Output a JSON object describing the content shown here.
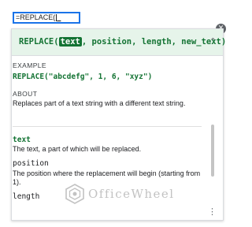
{
  "cell_input": {
    "prefix": "=REPLACE(",
    "suffix": "_"
  },
  "header": {
    "function_name": "REPLACE(",
    "highlighted_arg": "text",
    "rest_signature": ", position, length, new_text)"
  },
  "example": {
    "label": "EXAMPLE",
    "code": "REPLACE(\"abcdefg\", 1, 6, \"xyz\")"
  },
  "about": {
    "label": "ABOUT",
    "text": "Replaces part of a text string with a different text string."
  },
  "arguments": [
    {
      "name": "text",
      "description": "The text, a part of which will be replaced."
    },
    {
      "name": "position",
      "description": "The position where the replacement will begin (starting from 1)."
    },
    {
      "name": "length",
      "description": ""
    }
  ],
  "icons": {
    "close": "close-icon",
    "collapse": "chevron-up-icon",
    "menu": "more-vert-icon"
  },
  "watermark": {
    "text": "OfficeWheel"
  },
  "colors": {
    "accent": "#1a73e8",
    "header_bg": "#e6f4ea",
    "green": "#137333"
  }
}
